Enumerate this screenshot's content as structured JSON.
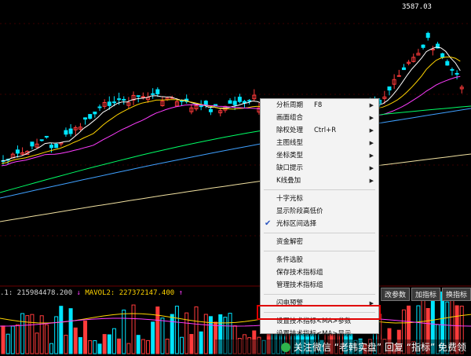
{
  "chart": {
    "peak_label": "3587.03",
    "vol_line": {
      "v1": ".1: 215984478.200",
      "v2": "MAVOL2: 227372147.400",
      "arrow": "↑"
    },
    "tabs": [
      "改参数",
      "加指标",
      "换指标"
    ]
  },
  "colors": {
    "up": "#ff3b3b",
    "down": "#00e5ff",
    "ma5": "#ffffff",
    "ma10": "#ffd400",
    "ma20": "#ff3cff",
    "ma60": "#00ff66",
    "ma120": "#3fa0ff",
    "ma250": "#f0e0a0"
  },
  "context_menu": {
    "items": [
      {
        "label": "分析周期",
        "shortcut": "F8",
        "submenu": true
      },
      {
        "label": "画面组合",
        "submenu": true
      },
      {
        "label": "除权处理",
        "shortcut": "Ctrl+R",
        "submenu": true
      },
      {
        "label": "主图线型",
        "submenu": true
      },
      {
        "label": "坐标类型",
        "submenu": true
      },
      {
        "label": "缺口提示",
        "submenu": true
      },
      {
        "label": "K线叠加",
        "submenu": true
      },
      {
        "sep": true
      },
      {
        "label": "十字光标"
      },
      {
        "label": "显示阶段高低价"
      },
      {
        "label": "光标区间选择",
        "checked": true
      },
      {
        "sep": true
      },
      {
        "label": "资金解密"
      },
      {
        "sep": true
      },
      {
        "label": "条件选股"
      },
      {
        "label": "保存技术指标组"
      },
      {
        "label": "管理技术指标组"
      },
      {
        "sep": true
      },
      {
        "label": "闪电预警",
        "submenu": true
      },
      {
        "sep": true
      },
      {
        "label": "设置技术指标<MA>参数",
        "highlighted": true
      },
      {
        "label": "设置技术指标<MA>显示"
      }
    ]
  },
  "watermark": {
    "text": "关注微信 “老韩实盘” 回复 “指标” 免费领"
  }
}
